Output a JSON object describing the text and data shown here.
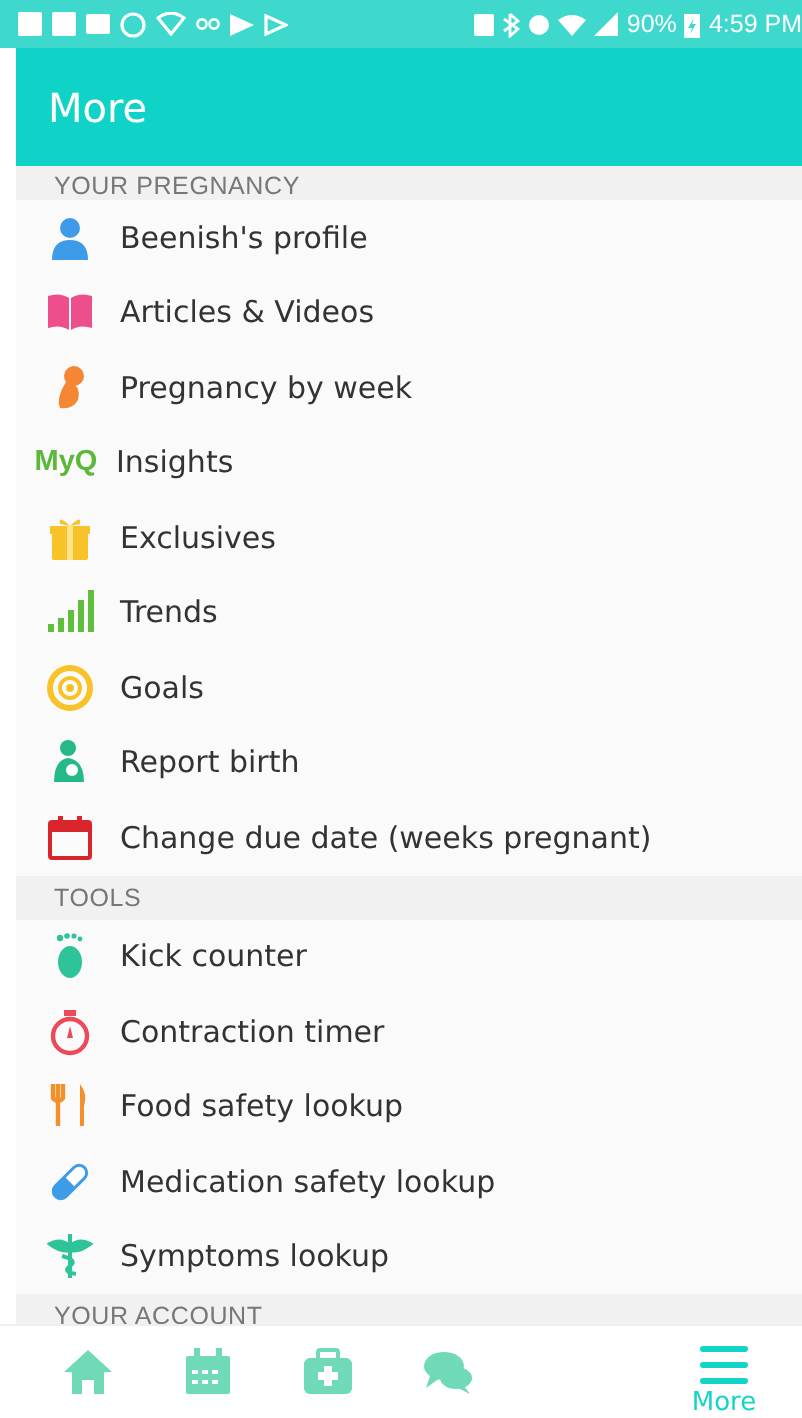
{
  "status_bar": {
    "battery": "90%",
    "time": "4:59 PM"
  },
  "app_bar": {
    "title": "More"
  },
  "sections": [
    {
      "header": "YOUR PREGNANCY",
      "items": [
        {
          "label": "Beenish's profile"
        },
        {
          "label": "Articles & Videos"
        },
        {
          "label": "Pregnancy by week"
        },
        {
          "label": "Insights",
          "logo": "MyQ"
        },
        {
          "label": "Exclusives"
        },
        {
          "label": "Trends"
        },
        {
          "label": "Goals"
        },
        {
          "label": "Report birth"
        },
        {
          "label": "Change due date (weeks pregnant)"
        }
      ]
    },
    {
      "header": "TOOLS",
      "items": [
        {
          "label": "Kick counter"
        },
        {
          "label": "Contraction timer"
        },
        {
          "label": "Food safety lookup"
        },
        {
          "label": "Medication safety lookup"
        },
        {
          "label": "Symptoms lookup"
        }
      ]
    },
    {
      "header": "YOUR ACCOUNT"
    }
  ],
  "bottom_nav": [
    {
      "selected": false
    },
    {
      "selected": false
    },
    {
      "selected": false
    },
    {
      "selected": false
    },
    {
      "label": "More",
      "selected": true
    }
  ]
}
